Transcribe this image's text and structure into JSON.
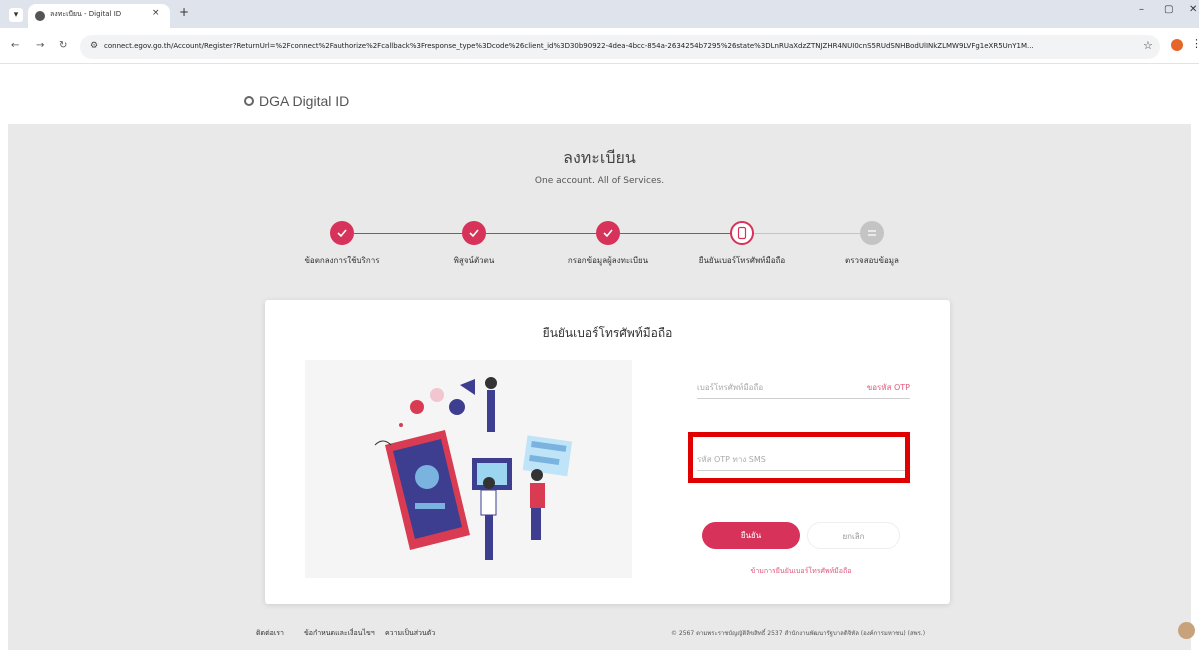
{
  "browser": {
    "tab_title": "ลงทะเบียน - Digital ID",
    "tab_close": "×",
    "new_tab": "+",
    "url": "connect.egov.go.th/Account/Register?ReturnUrl=%2Fconnect%2Fauthorize%2Fcallback%3Fresponse_type%3Dcode%26client_id%3D30b90922-4dea-4bcc-854a-2634254b7295%26state%3DLnRUaXdzZTNJZHR4NUI0cnS5RUdSNHBodUlINkZLMW9LVFg1eXR5UnY1M...",
    "icons": [
      "chevron-down-icon",
      "back-icon",
      "forward-icon",
      "reload-icon",
      "site-info-icon",
      "star-icon",
      "profile-icon",
      "menu-icon",
      "minimize-icon",
      "restore-icon",
      "close-icon"
    ]
  },
  "header": {
    "logo_text": "DGA Digital ID"
  },
  "page": {
    "title": "ลงทะเบียน",
    "subtitle": "One account. All of Services."
  },
  "steps": [
    {
      "label": "ข้อตกลงการใช้บริการ",
      "state": "done"
    },
    {
      "label": "พิสูจน์ตัวตน",
      "state": "done"
    },
    {
      "label": "กรอกข้อมูลผู้ลงทะเบียน",
      "state": "done"
    },
    {
      "label": "ยืนยันเบอร์โทรศัพท์มือถือ",
      "state": "current"
    },
    {
      "label": "ตรวจสอบข้อมูล",
      "state": "todo"
    }
  ],
  "colors": {
    "accent": "#d6325a",
    "highlight": "#e00000",
    "background": "#e9e9e9"
  },
  "card": {
    "title": "ยืนยันเบอร์โทรศัพท์มือถือ",
    "phone_placeholder": "เบอร์โทรศัพท์มือถือ",
    "request_otp": "ขอรหัส OTP",
    "otp_placeholder": "รหัส OTP ทาง SMS",
    "confirm_button": "ยืนยัน",
    "cancel_button": "ยกเลิก",
    "skip_link": "ข้ามการยืนยันเบอร์โทรศัพท์มือถือ"
  },
  "footer": {
    "links": [
      "ติดต่อเรา",
      "ข้อกำหนดและเงื่อนไขฯ",
      "ความเป็นส่วนตัว"
    ],
    "copyright": "© 2567 ตามพระราชบัญญัติลิขสิทธิ์ 2537 สำนักงานพัฒนารัฐบาลดิจิทัล (องค์การมหาชน) (สพร.)"
  }
}
